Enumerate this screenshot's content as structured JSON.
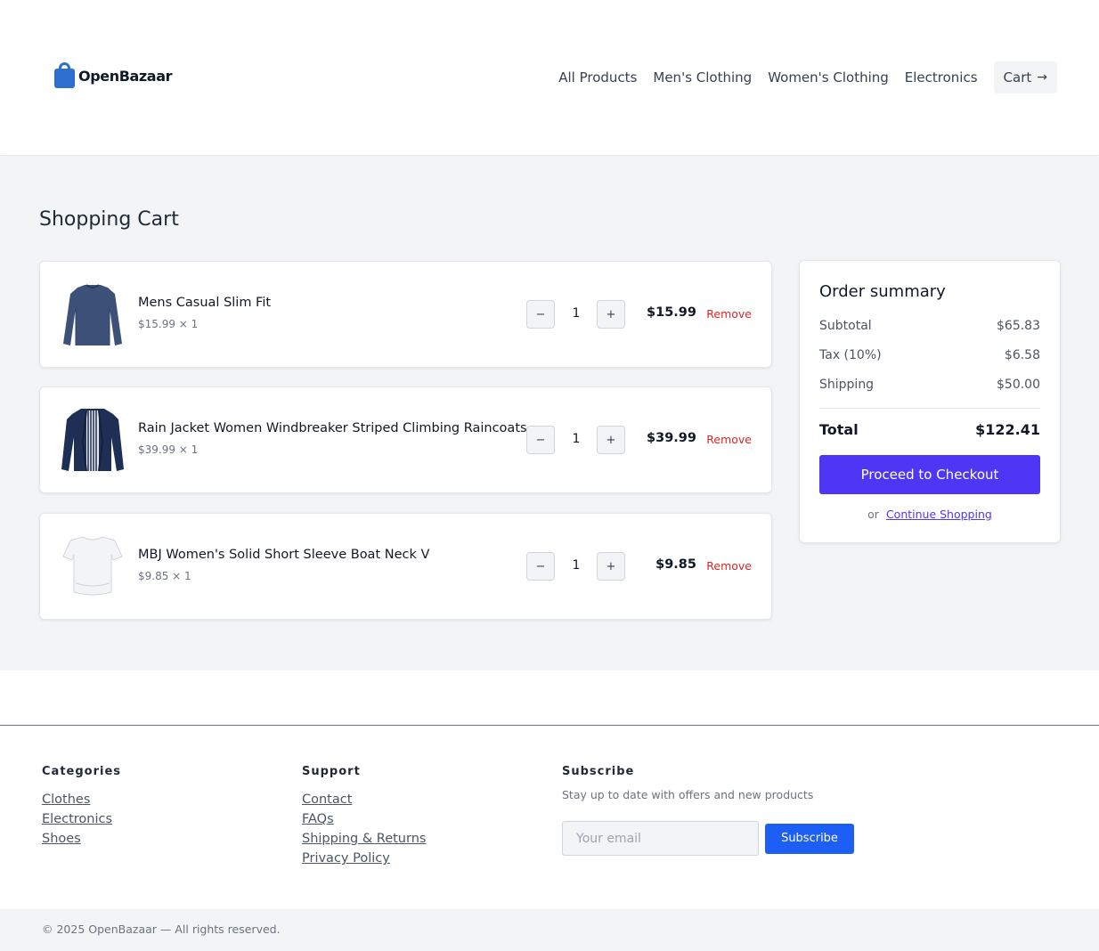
{
  "brand": {
    "name": "OpenBazaar",
    "color": "#2f6fd0"
  },
  "nav": {
    "links": [
      "All Products",
      "Men's Clothing",
      "Women's Clothing",
      "Electronics"
    ],
    "cart_label": "Cart",
    "cart_icon": "arrow-right-icon"
  },
  "page": {
    "title": "Shopping Cart"
  },
  "cart": {
    "items": [
      {
        "name": "Mens Casual Slim Fit",
        "unit_line": "$15.99 × 1",
        "quantity": "1",
        "line_total": "$15.99",
        "remove_label": "Remove",
        "thumb": "long-sleeve-shirt-navy"
      },
      {
        "name": "Rain Jacket Women Windbreaker Striped Climbing Raincoats",
        "unit_line": "$39.99 × 1",
        "quantity": "1",
        "line_total": "$39.99",
        "remove_label": "Remove",
        "thumb": "jacket-navy-striped"
      },
      {
        "name": "MBJ Women's Solid Short Sleeve Boat Neck V",
        "unit_line": "$9.85 × 1",
        "quantity": "1",
        "line_total": "$9.85",
        "remove_label": "Remove",
        "thumb": "short-sleeve-top-white"
      }
    ],
    "minus_symbol": "−",
    "plus_symbol": "+"
  },
  "summary": {
    "title": "Order summary",
    "subtotal_label": "Subtotal",
    "subtotal": "$65.83",
    "tax_label": "Tax (10%)",
    "tax": "$6.58",
    "shipping_label": "Shipping",
    "shipping": "$50.00",
    "total_label": "Total",
    "total": "$122.41",
    "checkout_label": "Proceed to Checkout",
    "or_text": "or",
    "continue_label": "Continue Shopping",
    "accent": "#4f36f5"
  },
  "footer": {
    "categories": {
      "title": "Categories",
      "links": [
        "Clothes",
        "Electronics",
        "Shoes"
      ]
    },
    "support": {
      "title": "Support",
      "links": [
        "Contact",
        "FAQs",
        "Shipping & Returns",
        "Privacy Policy"
      ]
    },
    "subscribe": {
      "title": "Subscribe",
      "description": "Stay up to date with offers and new products",
      "placeholder": "Your email",
      "button_label": "Subscribe"
    },
    "copyright": "© 2025 OpenBazaar — All rights reserved."
  }
}
